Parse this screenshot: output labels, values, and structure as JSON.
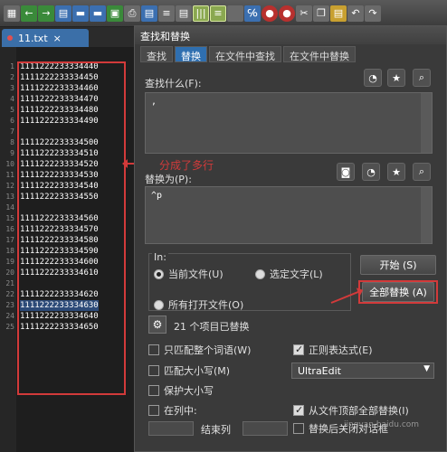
{
  "file_tab": {
    "name": "11.txt"
  },
  "editor": {
    "lines": [
      {
        "n": "1",
        "text": "1111222233334440"
      },
      {
        "n": "2",
        "text": "1111222233334450"
      },
      {
        "n": "3",
        "text": "1111222233334460"
      },
      {
        "n": "4",
        "text": "1111222233334470"
      },
      {
        "n": "5",
        "text": "1111222233334480"
      },
      {
        "n": "6",
        "text": "1111222233334490"
      },
      {
        "n": "7",
        "text": ""
      },
      {
        "n": "8",
        "text": "1111222233334500"
      },
      {
        "n": "9",
        "text": "1111222233334510"
      },
      {
        "n": "10",
        "text": "1111222233334520"
      },
      {
        "n": "11",
        "text": "1111222233334530"
      },
      {
        "n": "12",
        "text": "1111222233334540"
      },
      {
        "n": "13",
        "text": "1111222233334550"
      },
      {
        "n": "14",
        "text": ""
      },
      {
        "n": "15",
        "text": "1111222233334560"
      },
      {
        "n": "16",
        "text": "1111222233334570"
      },
      {
        "n": "17",
        "text": "1111222233334580"
      },
      {
        "n": "18",
        "text": "1111222233334590"
      },
      {
        "n": "19",
        "text": "1111222233334600"
      },
      {
        "n": "20",
        "text": "1111222233334610"
      },
      {
        "n": "21",
        "text": ""
      },
      {
        "n": "22",
        "text": "1111222233334620"
      },
      {
        "n": "23",
        "text": "1111222233334630"
      },
      {
        "n": "24",
        "text": "1111222233334640"
      },
      {
        "n": "25",
        "text": "1111222233334650"
      }
    ],
    "highlighted_line": "23"
  },
  "annotation": {
    "text": "分成了多行"
  },
  "dialog": {
    "title": "查找和替换",
    "tabs": [
      "查找",
      "替换",
      "在文件中查找",
      "在文件中替换"
    ],
    "active_tab": "替换",
    "find_label": "查找什么(F):",
    "find_value": ",",
    "replace_label": "替换为(P):",
    "replace_value": "^p",
    "in_label": "In:",
    "scope_current": "当前文件(U)",
    "scope_selection": "选定文字(L)",
    "scope_all_open": "所有打开文件(O)",
    "start_button": "开始 (S)",
    "replace_all_button": "全部替换 (A)",
    "status": "21 个项目已替换",
    "opt_whole_word": "只匹配整个词语(W)",
    "opt_match_case": "匹配大小写(M)",
    "opt_preserve_case": "保护大小写",
    "opt_in_column": "在列中:",
    "end_column": "结束列",
    "opt_regex": "正则表达式(E)",
    "regex_engine": "UltraEdit",
    "opt_from_top": "从文件顶部全部替换(I)",
    "opt_close_after": "替换后关闭对话框"
  },
  "watermark": "jingyan.baidu.com",
  "colors": {
    "accent": "#2f6fb0",
    "annotation": "#d23a3a"
  }
}
